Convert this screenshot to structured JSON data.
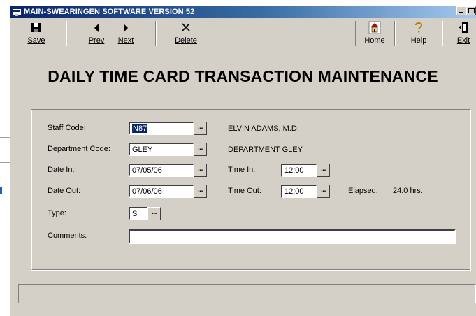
{
  "window": {
    "title": "MAIN-SWEARINGEN SOFTWARE VERSION 52"
  },
  "toolbar": {
    "save": "Save",
    "prev": "Prev",
    "next": "Next",
    "delete": "Delete",
    "home": "Home",
    "help": "Help",
    "exit": "Exit"
  },
  "heading": "DAILY TIME CARD TRANSACTION MAINTENANCE",
  "form": {
    "staff_code_label": "Staff Code:",
    "staff_code_value": "N87",
    "staff_name": "ELVIN ADAMS, M.D.",
    "department_code_label": "Department Code:",
    "department_code_value": "GLEY",
    "department_name": "DEPARTMENT GLEY",
    "date_in_label": "Date In:",
    "date_in_value": "07/05/06",
    "time_in_label": "Time In:",
    "time_in_value": "12:00",
    "date_out_label": "Date Out:",
    "date_out_value": "07/06/06",
    "time_out_label": "Time Out:",
    "time_out_value": "12:00",
    "elapsed_label": "Elapsed:",
    "elapsed_value": "24.0 hrs.",
    "type_label": "Type:",
    "type_value": "S",
    "comments_label": "Comments:",
    "comments_value": "",
    "lookup_label": "..."
  }
}
